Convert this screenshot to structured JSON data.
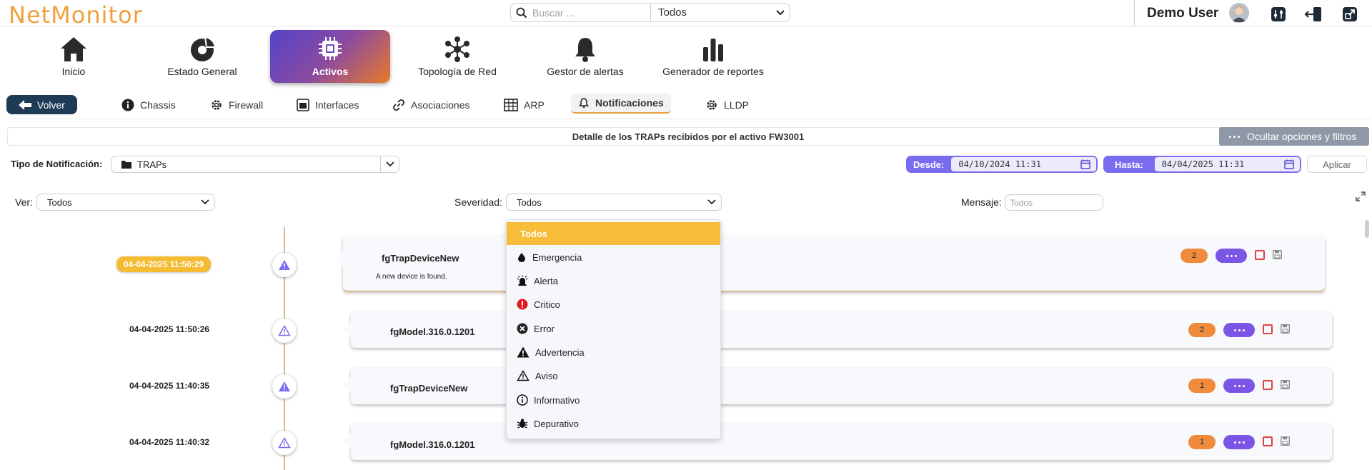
{
  "app": {
    "logo": "NetMonitor",
    "user": "Demo User"
  },
  "search": {
    "placeholder": "Buscar ...",
    "scope": "Todos"
  },
  "nav": {
    "items": [
      {
        "label": "Inicio",
        "icon": "home-icon"
      },
      {
        "label": "Estado General",
        "icon": "pie-chart-icon"
      },
      {
        "label": "Activos",
        "icon": "chip-icon"
      },
      {
        "label": "Topología de Red",
        "icon": "network-icon"
      },
      {
        "label": "Gestor de alertas",
        "icon": "bell-icon"
      },
      {
        "label": "Generador de reportes",
        "icon": "bar-chart-icon"
      }
    ]
  },
  "subtabs": {
    "back_label": "Volver",
    "items": [
      {
        "label": "Chassis",
        "icon": "info-icon"
      },
      {
        "label": "Firewall",
        "icon": "gear-icon"
      },
      {
        "label": "Interfaces",
        "icon": "interfaces-icon"
      },
      {
        "label": "Asociaciones",
        "icon": "link-icon"
      },
      {
        "label": "ARP",
        "icon": "table-icon"
      },
      {
        "label": "Notificaciones",
        "icon": "bell-icon"
      },
      {
        "label": "LLDP",
        "icon": "gear-icon"
      }
    ]
  },
  "banner": {
    "title": "Detalle de los TRAPs recibidos por el activo FW3001",
    "hide_label": "Ocultar opciones y filtros"
  },
  "filters": {
    "tipo_label": "Tipo de Notificación:",
    "tipo_value": "TRAPs",
    "desde_label": "Desde:",
    "desde_value": "04/10/2024 11:31",
    "hasta_label": "Hasta:",
    "hasta_value": "04/04/2025 11:31",
    "apply_label": "Aplicar",
    "ver_label": "Ver:",
    "ver_value": "Todos",
    "severidad_label": "Severidad:",
    "severidad_value": "Todos",
    "mensaje_label": "Mensaje:",
    "mensaje_placeholder": "Todos"
  },
  "severity_options": [
    {
      "label": "Todos",
      "icon": ""
    },
    {
      "label": "Emergencia",
      "icon": "drop-icon"
    },
    {
      "label": "Alerta",
      "icon": "siren-icon"
    },
    {
      "label": "Critico",
      "icon": "critical-icon"
    },
    {
      "label": "Error",
      "icon": "error-icon"
    },
    {
      "label": "Advertencia",
      "icon": "warning-solid-icon"
    },
    {
      "label": "Aviso",
      "icon": "warning-outline-icon"
    },
    {
      "label": "Informativo",
      "icon": "info-icon"
    },
    {
      "label": "Depurativo",
      "icon": "bug-icon"
    }
  ],
  "events": [
    {
      "time": "04-04-2025 11:50:29",
      "name": "fgTrapDeviceNew",
      "description": "A new device is found.",
      "count": "2"
    },
    {
      "time": "04-04-2025 11:50:26",
      "name": "fgModel.316.0.1201",
      "description": "",
      "count": "2"
    },
    {
      "time": "04-04-2025 11:40:35",
      "name": "fgTrapDeviceNew",
      "description": "",
      "count": "1"
    },
    {
      "time": "04-04-2025 11:40:32",
      "name": "fgModel.316.0.1201",
      "description": "",
      "count": "1"
    }
  ],
  "colors": {
    "accent": "#7b55e6",
    "brand_orange": "#f0a03c",
    "badge": "#f08a3c",
    "highlight": "#f7bd3a",
    "dark_nav": "#1e3a55"
  }
}
